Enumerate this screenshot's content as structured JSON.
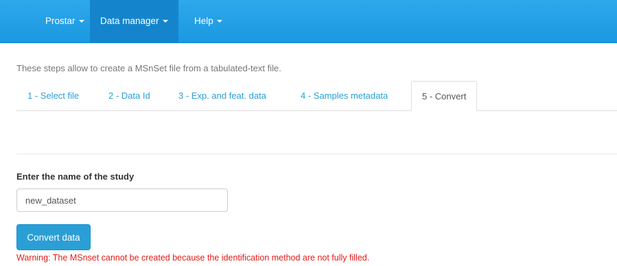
{
  "navbar": {
    "items": [
      {
        "label": "Prostar",
        "has_caret": true,
        "active": false
      },
      {
        "label": "Data manager",
        "has_caret": true,
        "active": true
      },
      {
        "label": "Help",
        "has_caret": true,
        "active": false
      }
    ]
  },
  "intro_text": "These steps allow to create a MSnSet file from a tabulated-text file.",
  "tabs": [
    {
      "label": "1 - Select file",
      "active": false
    },
    {
      "label": "2 - Data Id",
      "active": false
    },
    {
      "label": "3 - Exp. and feat. data",
      "active": false
    },
    {
      "label": "4 - Samples metadata",
      "active": false
    },
    {
      "label": "5 - Convert",
      "active": true
    }
  ],
  "study_form": {
    "label": "Enter the name of the study",
    "value": "new_dataset",
    "button_label": "Convert data"
  },
  "warning": "Warning: The MSnset cannot be created because the identification method are not fully filled.",
  "colors": {
    "navbar": "#1a98e0",
    "navbar_active": "#1485cd",
    "link": "#2a9fd6",
    "button": "#2a9fd6",
    "warning": "#e41b17"
  }
}
